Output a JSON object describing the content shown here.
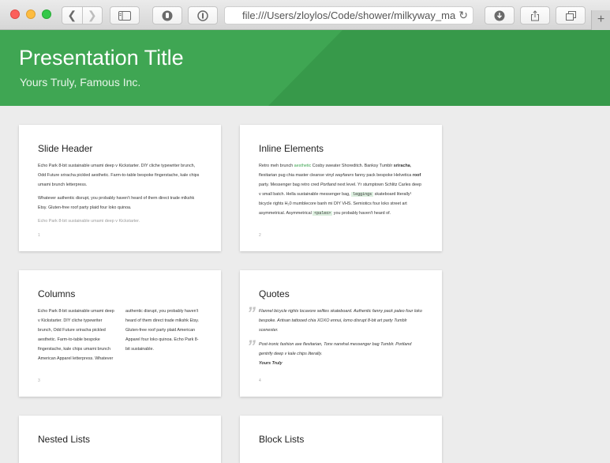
{
  "browser": {
    "url": "file:///Users/zloylos/Code/shower/milkyway_ma",
    "new_tab_label": "+"
  },
  "header": {
    "title": "Presentation Title",
    "subtitle": "Yours Truly, Famous Inc."
  },
  "slides": [
    {
      "header": "Slide Header",
      "number": "1",
      "p1": "Echo Park 8-bit sustainable umami deep v Kickstarter. DIY cliche typewriter brunch, Odd Future sriracha pickled aesthetic. Farm-to-table bespoke fingerstache, kale chips umami brunch letterpress.",
      "p2": "Whatever authentic disrupt, you probably haven't heard of them direct trade mlkshk Etsy. Gluten-free roof party plaid four loko quinoa.",
      "p3": "Echo Park 8-bit sustainable umami deep v Kickstarter."
    },
    {
      "header": "Inline Elements",
      "number": "2",
      "t1": "Retro meh brunch ",
      "t_link": "aesthetic",
      "t2": " Cosby sweater Shoreditch. Banksy Tumblr ",
      "t_bold1": "sriracha",
      "t3": ", flexitarian pug chia master cleanse vinyl ",
      "t_italic1": "wayfarers",
      "t4": " fanny pack bespoke Helvetica ",
      "t_bold2": "roof",
      "t5": " party. Messenger bag retro cred ",
      "t_italic2": "Portland",
      "t6": " next level. Yr stumptown Schlitz Carles deep v small batch. Hella sustainable messenger bag, ",
      "t_code1": "leggings",
      "t7": " skateboard literally¹ bicycle rights H₂0 mumblecore banh mi DIY VHS. Semiotics four loko street art asymmetrical. Asymmetrical ",
      "t_code2": "<paleo>",
      "t8": " you probably haven't heard of."
    },
    {
      "header": "Columns",
      "number": "3",
      "col1": "Echo Park 8-bit sustainable umami deep v Kickstarter. DIY cliche typewriter brunch, Odd Future sriracha pickled aesthetic. Farm-to-table bespoke fingerstache, kale chips umami brunch American Apparel letterpress. Whatever",
      "col2": "authentic disrupt, you probably haven't heard of them direct trade mlkshk Etsy. Gluten-free roof party plaid American Apparel four loko quinoa. Echo Park 8-bit sustainable."
    },
    {
      "header": "Quotes",
      "number": "4",
      "quote_mark": "”",
      "q1": "Flannel bicycle rights locavore selfies skateboard. Authentic fanny pack paleo four loko bespoke. Artisan tattooed chia XOXO ennui, lomo disrupt 8-bit art party Tumblr scenester.",
      "q2": "Post-ironic fashion axe flexitarian, Tonx narwhal messenger bag Tumblr. Portland gentrify deep v kale chips literally.",
      "q2_author": "Yours Truly"
    },
    {
      "header": "Nested Lists"
    },
    {
      "header": "Block Lists"
    }
  ]
}
